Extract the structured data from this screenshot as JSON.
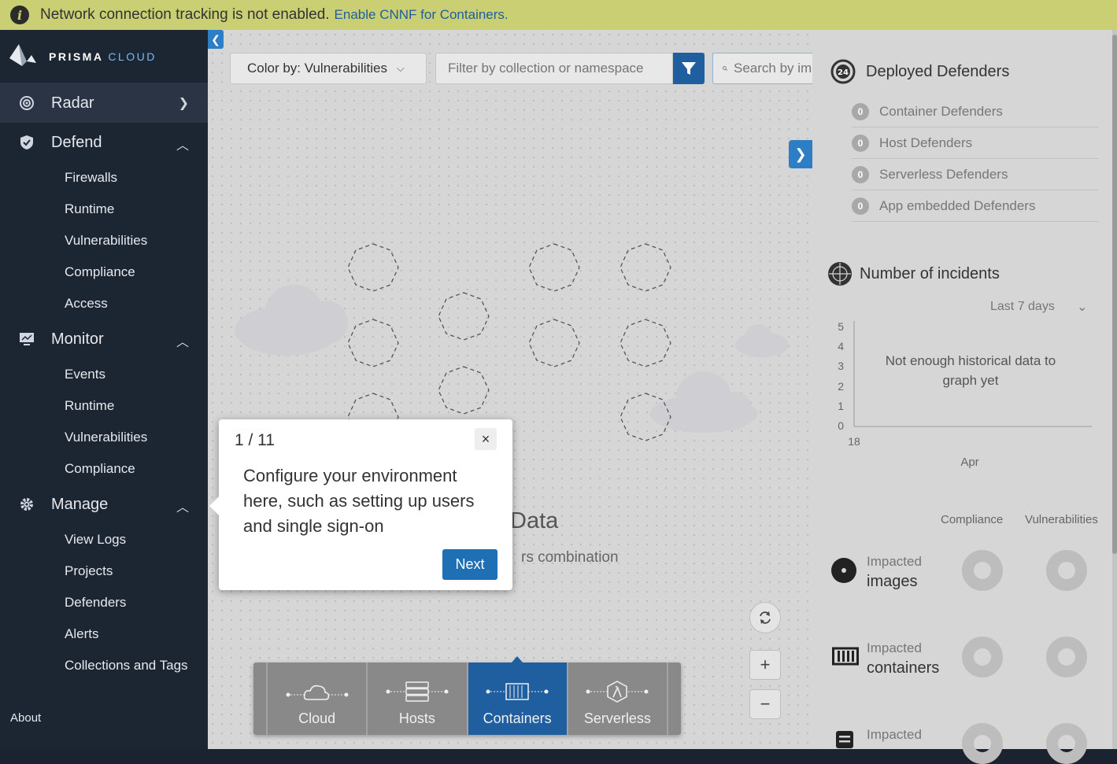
{
  "banner": {
    "message": "Network connection tracking is not enabled.",
    "link": "Enable CNNF for Containers.",
    "info_icon": "i"
  },
  "sidebar": {
    "logo_text": "PRISMA",
    "logo_sub": "CLOUD",
    "sections": [
      {
        "label": "Radar",
        "icon": "radar-icon"
      },
      {
        "label": "Defend",
        "icon": "shield-icon",
        "items": [
          "Firewalls",
          "Runtime",
          "Vulnerabilities",
          "Compliance",
          "Access"
        ]
      },
      {
        "label": "Monitor",
        "icon": "monitor-icon",
        "items": [
          "Events",
          "Runtime",
          "Vulnerabilities",
          "Compliance"
        ]
      },
      {
        "label": "Manage",
        "icon": "gear-icon",
        "items": [
          "View Logs",
          "Projects",
          "Defenders",
          "Alerts",
          "Collections and Tags"
        ]
      }
    ],
    "about": "About"
  },
  "toolbar": {
    "color_by": "Color by: Vulnerabilities",
    "filter_placeholder": "Filter by collection or namespace",
    "search_placeholder": "Search by image"
  },
  "canvas": {
    "nodata_title": "Data",
    "nodata_sub": "rs combination",
    "types": [
      "Cloud",
      "Hosts",
      "Containers",
      "Serverless"
    ],
    "active_type": "Containers"
  },
  "tour": {
    "step": "1 / 11",
    "message": "Configure your environment here, such as setting up users and single sign-on",
    "next": "Next",
    "close": "×"
  },
  "right_panel": {
    "defenders_title": "Deployed Defenders",
    "defenders": [
      {
        "count": "0",
        "label": "Container Defenders"
      },
      {
        "count": "0",
        "label": "Host Defenders"
      },
      {
        "count": "0",
        "label": "Serverless Defenders"
      },
      {
        "count": "0",
        "label": "App embedded Defenders"
      }
    ],
    "incidents_title": "Number of incidents",
    "period": "Last 7 days",
    "chart_message": "Not enough historical data to graph yet",
    "y_ticks": [
      "5",
      "4",
      "3",
      "2",
      "1",
      "0"
    ],
    "x_tick": "18",
    "x_month": "Apr",
    "col_compliance": "Compliance",
    "col_vulnerabilities": "Vulnerabilities",
    "impacted": [
      {
        "label": "Impacted",
        "target": "images"
      },
      {
        "label": "Impacted",
        "target": "containers"
      },
      {
        "label": "Impacted",
        "target": ""
      }
    ]
  }
}
